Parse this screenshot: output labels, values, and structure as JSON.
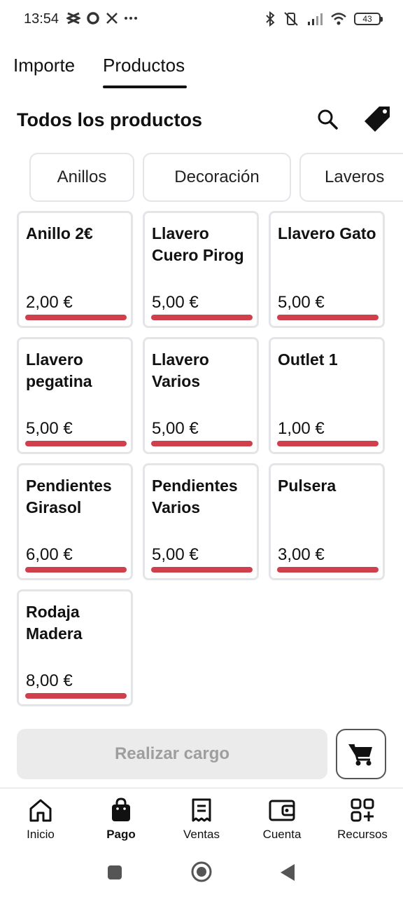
{
  "status_bar": {
    "time": "13:54",
    "battery": "43",
    "left_icons": [
      "capcut-icon",
      "circle-app-icon",
      "x-logo-icon",
      "more-dots-icon"
    ],
    "right_icons": [
      "bluetooth-icon",
      "vibrate-off-icon",
      "signal-icon",
      "wifi-icon",
      "battery-icon"
    ]
  },
  "tabs": [
    {
      "label": "Importe",
      "active": false
    },
    {
      "label": "Productos",
      "active": true
    }
  ],
  "header": {
    "title": "Todos los productos",
    "search_icon": "search-icon",
    "tag_icon": "tag-icon"
  },
  "categories": [
    "Anillos",
    "Decoración",
    "Laveros"
  ],
  "products": [
    {
      "name": "Anillo 2€",
      "price": "2,00 €"
    },
    {
      "name": "Llavero Cuero Pirog",
      "price": "5,00 €"
    },
    {
      "name": "Llavero Gato",
      "price": "5,00 €"
    },
    {
      "name": "Llavero pegatina",
      "price": "5,00 €"
    },
    {
      "name": "Llavero Varios",
      "price": "5,00 €"
    },
    {
      "name": "Outlet 1",
      "price": "1,00 €"
    },
    {
      "name": "Pendientes Girasol",
      "price": "6,00 €"
    },
    {
      "name": "Pendientes Varios",
      "price": "5,00 €"
    },
    {
      "name": "Pulsera",
      "price": "3,00 €"
    },
    {
      "name": "Rodaja Madera",
      "price": "8,00 €"
    }
  ],
  "accent_color": "#d0404c",
  "actions": {
    "charge_label": "Realizar cargo",
    "cart_icon": "cart-icon"
  },
  "bottom_nav": [
    {
      "label": "Inicio",
      "icon": "home-icon",
      "active": false
    },
    {
      "label": "Pago",
      "icon": "shopping-bag-icon",
      "active": true
    },
    {
      "label": "Ventas",
      "icon": "receipt-icon",
      "active": false
    },
    {
      "label": "Cuenta",
      "icon": "wallet-icon",
      "active": false
    },
    {
      "label": "Recursos",
      "icon": "apps-add-icon",
      "active": false
    }
  ],
  "system_nav": [
    "recents-button",
    "home-button",
    "back-button"
  ]
}
